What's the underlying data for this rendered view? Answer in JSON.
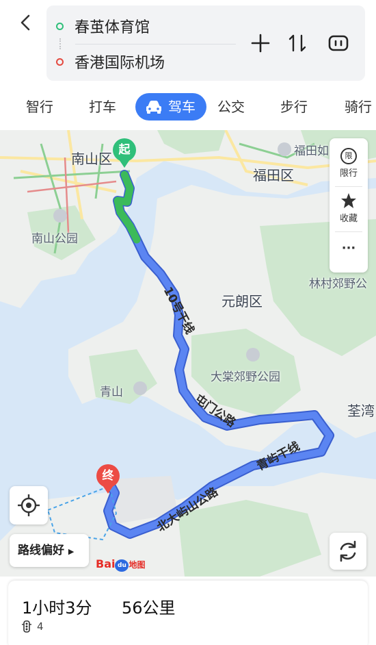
{
  "route": {
    "start": "春茧体育馆",
    "end": "香港国际机场"
  },
  "tabs": [
    {
      "label": "智行"
    },
    {
      "label": "打车"
    },
    {
      "label": "驾车",
      "active": true
    },
    {
      "label": "公交"
    },
    {
      "label": "步行"
    },
    {
      "label": "骑行"
    }
  ],
  "map": {
    "labels": {
      "nanshan_district": "南山区",
      "futian_area": "福田如",
      "futian_district": "福田区",
      "nanshan_park": "南山公园",
      "yuen_long": "元朗区",
      "lam_tsuen": "林村郊野公",
      "tai_lam": "大棠郊野公园",
      "castle_peak": "青山",
      "tsuen_wan": "荃湾"
    },
    "roads": {
      "r10": "10号干线",
      "tuen_mun_road": "屯门公路",
      "tsing_yi": "青屿干线",
      "north_lantau": "北大屿山公路"
    },
    "pins": {
      "start": "起",
      "end": "终"
    },
    "side_panel": {
      "restriction_icon_text": "限",
      "restriction": "限行",
      "favorite": "收藏",
      "more": "···"
    },
    "route_preference": "路线偏好",
    "logo": {
      "bai": "Bai",
      "du": "du",
      "ditu": "地图"
    },
    "colors": {
      "route_blue": "#4f78ea",
      "route_green": "#3cba5a",
      "start_green": "#2fbf7a",
      "end_red": "#ec4b44",
      "active_tab": "#3b7cf5"
    }
  },
  "summary": {
    "duration": "1小时3分",
    "distance": "56公里",
    "traffic_lights": "4"
  }
}
